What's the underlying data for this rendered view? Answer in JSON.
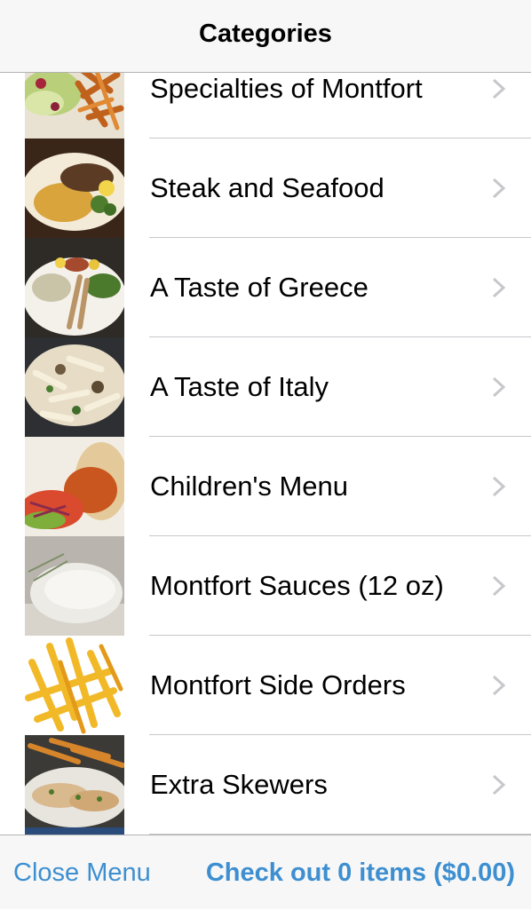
{
  "nav": {
    "title": "Categories"
  },
  "categories": [
    {
      "label": "Specialties of Montfort",
      "icon": "food-salad-fries-image"
    },
    {
      "label": "Steak and Seafood",
      "icon": "food-steak-image"
    },
    {
      "label": "A Taste of Greece",
      "icon": "food-greek-plate-image"
    },
    {
      "label": "A Taste of Italy",
      "icon": "food-pasta-image"
    },
    {
      "label": "Children's Menu",
      "icon": "food-wrap-image"
    },
    {
      "label": "Montfort Sauces (12 oz)",
      "icon": "food-sauce-image"
    },
    {
      "label": "Montfort Side Orders",
      "icon": "food-fries-image"
    },
    {
      "label": "Extra Skewers",
      "icon": "food-skewers-image"
    }
  ],
  "toolbar": {
    "close_label": "Close Menu",
    "checkout_label": "Check out 0 items ($0.00)"
  },
  "colors": {
    "accent": "#3d8fd1",
    "bar_background": "#f7f7f7",
    "separator": "#c8c7cc",
    "chevron": "#c7c7cc"
  }
}
